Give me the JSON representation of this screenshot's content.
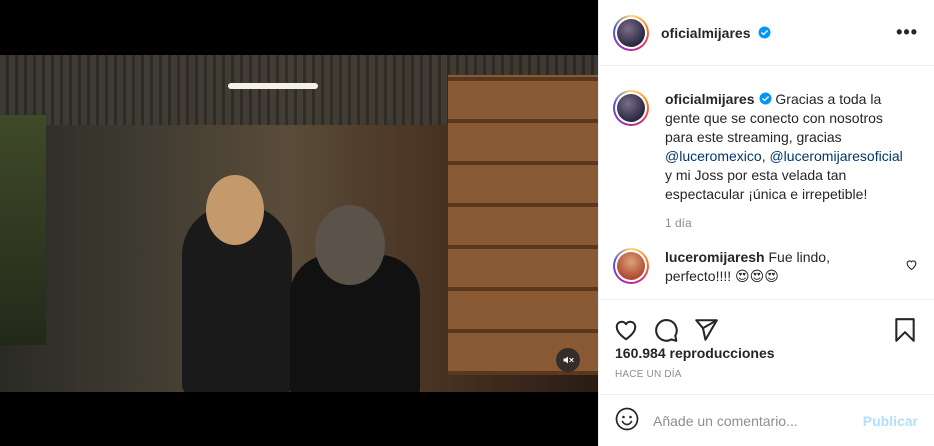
{
  "post": {
    "author": "oficialmijares",
    "caption_text": " Gracias a toda la gente que se conecto con nosotros para este streaming, gracias ",
    "mention_1": "@luceromexico",
    "separator": ", ",
    "mention_2": "@luceromijaresoficial",
    "caption_end": " y mi Joss por esta velada tan espectacular ¡única e irrepetible!",
    "time_ago": "1 día",
    "views": "160.984 reproducciones",
    "date": "HACE UN DÍA",
    "more_label": "•••"
  },
  "comments": [
    {
      "author": "luceromijaresh",
      "text": " Fue lindo, perfecto!!!! 😍😍😍"
    }
  ],
  "add_comment": {
    "placeholder": "Añade un comentario...",
    "publish_label": "Publicar"
  },
  "icons": {
    "verified": "verified-badge-icon",
    "like": "heart-outline-icon",
    "comment": "speech-bubble-icon",
    "share": "paper-plane-icon",
    "save": "bookmark-icon",
    "emoji": "smiley-icon",
    "mute": "speaker-muted-icon"
  },
  "colors": {
    "accent": "#0095f6",
    "publish_disabled": "#b2dffc",
    "mention": "#00376b",
    "muted_text": "#8e8e8e"
  }
}
